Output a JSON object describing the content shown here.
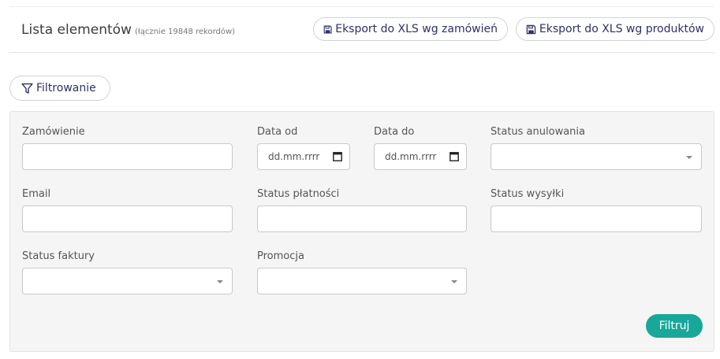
{
  "header": {
    "title": "Lista elementów",
    "record_count": "(łącznie 19848 rekordów)"
  },
  "actions": {
    "export_orders": "Eksport do XLS wg zamówień",
    "export_products": "Eksport do XLS wg produktów",
    "filter_toggle": "Filtrowanie"
  },
  "filters": {
    "order_label": "Zamówienie",
    "order_value": "",
    "date_from_label": "Data od",
    "date_from_value": "dd.mm.rrrr",
    "date_to_label": "Data do",
    "date_to_value": "dd.mm.rrrr",
    "cancel_status_label": "Status anulowania",
    "cancel_status_value": "",
    "email_label": "Email",
    "email_value": "",
    "payment_status_label": "Status płatności",
    "payment_status_value": "",
    "shipping_status_label": "Status wysyłki",
    "shipping_status_value": "",
    "invoice_status_label": "Status faktury",
    "invoice_status_value": "",
    "promo_label": "Promocja",
    "promo_value": "",
    "submit_label": "Filtruj"
  },
  "colors": {
    "accent": "#17a89a",
    "button_text": "#2f2f6b",
    "panel_bg": "#f5f5f5"
  },
  "icons": {
    "export": "floppy-disk-icon",
    "filter": "funnel-icon",
    "calendar": "calendar-icon",
    "dropdown": "caret-down-icon"
  }
}
